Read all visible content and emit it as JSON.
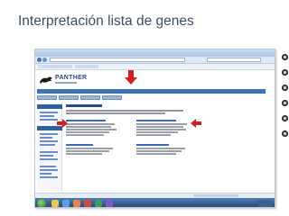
{
  "slide": {
    "title": "Interpretación lista de genes"
  },
  "screenshot": {
    "site": {
      "brand": "PANTHER"
    },
    "colors": {
      "browser_chrome": "#a9c4e3",
      "site_nav": "#3d74b4",
      "link_blue": "#3a67c2",
      "annotation_arrow": "#d81e1e",
      "taskbar": "#233f68"
    }
  },
  "side_controls": {
    "icons": [
      "home-icon",
      "previous-icon",
      "slide-view-icon",
      "options-icon",
      "next-icon",
      "end-icon"
    ]
  }
}
